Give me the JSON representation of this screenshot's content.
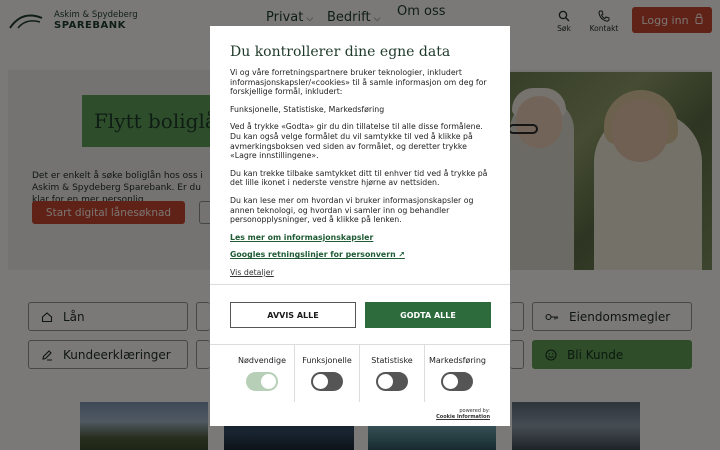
{
  "header": {
    "logo_line1": "Askim & Spydeberg",
    "logo_line2": "SPAREBANK",
    "nav": [
      {
        "label": "Privat"
      },
      {
        "label": "Bedrift"
      },
      {
        "label": "Om oss"
      }
    ],
    "search_label": "Søk",
    "contact_label": "Kontakt",
    "login_label": "Logg inn"
  },
  "hero": {
    "banner_text": "Flytt boliglån",
    "text": "Det er enkelt å søke boliglån hos oss i Askim & Spydeberg Sparebank. Er du klar for en mer personlig",
    "cta_label": "Start digital lånesøknad"
  },
  "quick_links": [
    {
      "label": "Lån",
      "icon": "house-icon"
    },
    {
      "label": "Eiendomsmegler",
      "icon": "key-icon"
    },
    {
      "label": "Kundeerklæringer",
      "icon": "pen-icon"
    },
    {
      "label": "Bli Kunde",
      "icon": "smile-icon"
    }
  ],
  "dialog": {
    "title": "Du kontrollerer dine egne data",
    "para1": "Vi og våre forretningspartnere bruker teknologier, inkludert informasjonskapsler/«cookies» til å samle informasjon om deg for forskjellige formål, inkludert:",
    "para2": "Funksjonelle, Statistiske, Markedsføring",
    "para3": "Ved å trykke «Godta» gir du din tillatelse til alle disse formålene. Du kan også velge formålet du vil samtykke til ved å klikke på avmerkingsboksen ved siden av formålet, og deretter trykke «Lagre innstillingene».",
    "para4": "Du kan trekke tilbake samtykket ditt til enhver tid ved å trykke på det lille ikonet i nederste venstre hjørne av nettsiden.",
    "para5": "Du kan lese mer om hvordan vi bruker informasjonskapsler og annen teknologi, og hvordan vi samler inn og behandler personopplysninger, ved å klikke på lenken.",
    "link_cookies": "Les mer om informasjonskapsler",
    "link_google": "Googles retningslinjer for personvern",
    "link_details": "Vis detaljer",
    "reject_label": "AVVIS ALLE",
    "accept_label": "GODTA ALLE",
    "categories": [
      {
        "label": "Nødvendige",
        "on": true,
        "disabled": true
      },
      {
        "label": "Funksjonelle",
        "on": false
      },
      {
        "label": "Statistiske",
        "on": false
      },
      {
        "label": "Markedsføring",
        "on": false
      }
    ],
    "powered_by": "powered by:",
    "powered_brand": "Cookie Information"
  },
  "colors": {
    "accent_red": "#c0452f",
    "accent_green": "#2e6b3c",
    "hero_green": "#5b9a56"
  }
}
